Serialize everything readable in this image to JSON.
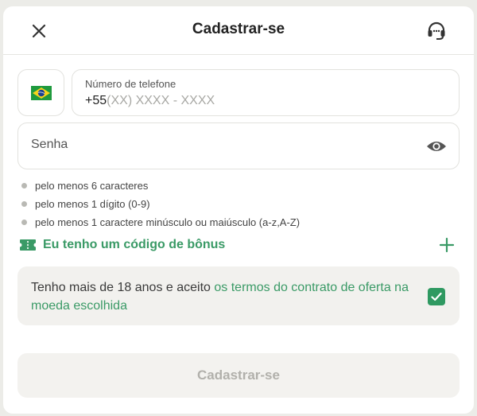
{
  "header": {
    "title": "Cadastrar-se",
    "close_icon": "close-icon",
    "support_icon": "headset-support-icon"
  },
  "phone": {
    "country_flag": "brazil-flag-icon",
    "label": "Número de telefone",
    "prefix": "+55",
    "placeholder": "(XX) XXXX - XXXX"
  },
  "password": {
    "placeholder": "Senha",
    "toggle_icon": "eye-icon"
  },
  "password_rules": [
    "pelo menos 6 caracteres",
    "pelo menos 1 dígito (0-9)",
    "pelo menos 1 caractere minúsculo ou maiúsculo (a-z,A-Z)"
  ],
  "bonus": {
    "label": "Eu tenho um código de bônus",
    "icon": "ticket-icon",
    "expand_icon": "plus-icon"
  },
  "terms": {
    "text": "Tenho mais de 18 anos e aceito ",
    "link_text": "os termos do contrato de oferta na moeda escolhida",
    "checked": true
  },
  "submit": {
    "label": "Cadastrar-se"
  },
  "colors": {
    "accent": "#3a9a66",
    "checkbox": "#2f9961",
    "disabled_text": "#b1b0ab"
  }
}
